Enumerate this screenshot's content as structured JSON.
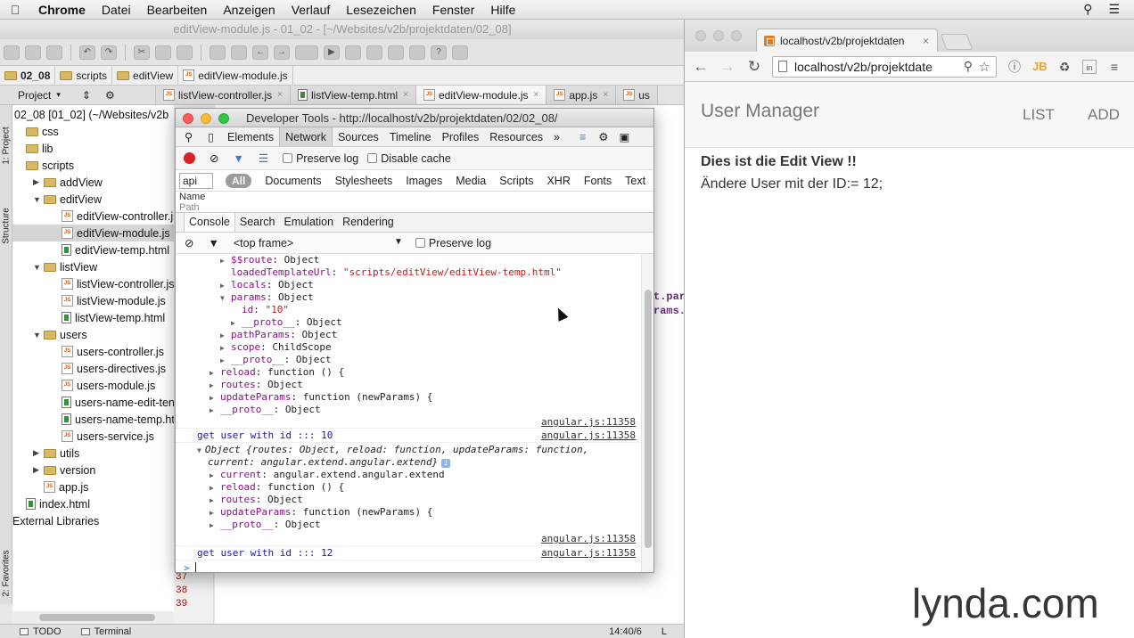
{
  "menubar": {
    "app": "Chrome",
    "items": [
      "Datei",
      "Bearbeiten",
      "Anzeigen",
      "Verlauf",
      "Lesezeichen",
      "Fenster",
      "Hilfe"
    ]
  },
  "ide": {
    "title": "editView-module.js - 01_02 - [~/Websites/v2b/projektdaten/02_08]",
    "breadcrumb": [
      "02_08",
      "scripts",
      "editView",
      "editView-module.js"
    ],
    "project_dropdown": "Project",
    "tabs": [
      {
        "label": "listView-controller.js",
        "type": "js"
      },
      {
        "label": "listView-temp.html",
        "type": "html"
      },
      {
        "label": "editView-module.js",
        "type": "js",
        "active": true
      },
      {
        "label": "app.js",
        "type": "js"
      },
      {
        "label": "us",
        "type": "js"
      }
    ],
    "side_tabs": {
      "project": "1: Project",
      "structure": "Structure",
      "favorites": "2: Favorites"
    },
    "tree_root": "02_08 [01_02] (~/Websites/v2b",
    "tree": [
      {
        "label": "css",
        "kind": "folder",
        "depth": 0,
        "arrow": "none"
      },
      {
        "label": "lib",
        "kind": "folder",
        "depth": 0,
        "arrow": "none"
      },
      {
        "label": "scripts",
        "kind": "folder",
        "depth": 0,
        "arrow": "none"
      },
      {
        "label": "addView",
        "kind": "folder",
        "depth": 1,
        "arrow": "right"
      },
      {
        "label": "editView",
        "kind": "folder",
        "depth": 1,
        "arrow": "down"
      },
      {
        "label": "editView-controller.js",
        "kind": "js",
        "depth": 2
      },
      {
        "label": "editView-module.js",
        "kind": "js",
        "depth": 2,
        "selected": true
      },
      {
        "label": "editView-temp.html",
        "kind": "html",
        "depth": 2
      },
      {
        "label": "listView",
        "kind": "folder",
        "depth": 1,
        "arrow": "down"
      },
      {
        "label": "listView-controller.js",
        "kind": "js",
        "depth": 2
      },
      {
        "label": "listView-module.js",
        "kind": "js",
        "depth": 2
      },
      {
        "label": "listView-temp.html",
        "kind": "html",
        "depth": 2
      },
      {
        "label": "users",
        "kind": "folder",
        "depth": 1,
        "arrow": "down"
      },
      {
        "label": "users-controller.js",
        "kind": "js",
        "depth": 2
      },
      {
        "label": "users-directives.js",
        "kind": "js",
        "depth": 2
      },
      {
        "label": "users-module.js",
        "kind": "js",
        "depth": 2
      },
      {
        "label": "users-name-edit-ten",
        "kind": "html",
        "depth": 2
      },
      {
        "label": "users-name-temp.ht",
        "kind": "html",
        "depth": 2
      },
      {
        "label": "users-service.js",
        "kind": "js",
        "depth": 2
      },
      {
        "label": "utils",
        "kind": "folder",
        "depth": 1,
        "arrow": "right"
      },
      {
        "label": "version",
        "kind": "folder",
        "depth": 1,
        "arrow": "right"
      },
      {
        "label": "app.js",
        "kind": "js",
        "depth": 1
      },
      {
        "label": "index.html",
        "kind": "html",
        "depth": 0
      },
      {
        "label": "External Libraries",
        "kind": "lib",
        "depth": -1
      }
    ],
    "gutter_lines": [
      "37",
      "38",
      "39"
    ],
    "editor_peek": [
      "t.par",
      "rams."
    ],
    "bottom_tabs": [
      "TODO",
      "Terminal"
    ],
    "cursor_pos": "14:40/6",
    "status_tail": "L"
  },
  "devtools": {
    "title": "Developer Tools - http://localhost/v2b/projektdaten/02/02_08/",
    "panels": [
      "Elements",
      "Network",
      "Sources",
      "Timeline",
      "Profiles",
      "Resources"
    ],
    "active_panel": "Network",
    "more": "»",
    "preserve_log": "Preserve log",
    "disable_cache": "Disable cache",
    "filter_value": "api",
    "filter_all": "All",
    "filter_types": [
      "Documents",
      "Stylesheets",
      "Images",
      "Media",
      "Scripts",
      "XHR",
      "Fonts",
      "Text"
    ],
    "name_header": "Name",
    "path_header": "Path",
    "drawer_tabs": [
      "Console",
      "Search",
      "Emulation",
      "Rendering"
    ],
    "frame_select": "<top frame>",
    "console_preserve": "Preserve log",
    "source_ref": "angular.js:11358",
    "prompt": ">",
    "console_lines": [
      {
        "indent": 4,
        "arrow": "▶",
        "parts": [
          {
            "t": "$$route",
            "c": "k"
          },
          {
            "t": ": Object",
            "c": "v"
          }
        ]
      },
      {
        "indent": 4,
        "arrow": "",
        "parts": [
          {
            "t": "loadedTemplateUrl",
            "c": "k"
          },
          {
            "t": ": ",
            "c": "v"
          },
          {
            "t": "\"scripts/editView/editView-temp.html\"",
            "c": "s"
          }
        ]
      },
      {
        "indent": 4,
        "arrow": "▶",
        "parts": [
          {
            "t": "locals",
            "c": "k"
          },
          {
            "t": ": Object",
            "c": "v"
          }
        ]
      },
      {
        "indent": 4,
        "arrow": "▼",
        "parts": [
          {
            "t": "params",
            "c": "k"
          },
          {
            "t": ": Object",
            "c": "v"
          }
        ]
      },
      {
        "indent": 5,
        "arrow": "",
        "parts": [
          {
            "t": "id",
            "c": "k"
          },
          {
            "t": ": ",
            "c": "v"
          },
          {
            "t": "\"10\"",
            "c": "s"
          }
        ]
      },
      {
        "indent": 5,
        "arrow": "▶",
        "parts": [
          {
            "t": "__proto__",
            "c": "k"
          },
          {
            "t": ": Object",
            "c": "v"
          }
        ]
      },
      {
        "indent": 4,
        "arrow": "▶",
        "parts": [
          {
            "t": "pathParams",
            "c": "k"
          },
          {
            "t": ": Object",
            "c": "v"
          }
        ]
      },
      {
        "indent": 4,
        "arrow": "▶",
        "parts": [
          {
            "t": "scope",
            "c": "k"
          },
          {
            "t": ": ChildScope",
            "c": "v"
          }
        ]
      },
      {
        "indent": 4,
        "arrow": "▶",
        "parts": [
          {
            "t": "__proto__",
            "c": "k"
          },
          {
            "t": ": Object",
            "c": "v"
          }
        ]
      },
      {
        "indent": 3,
        "arrow": "▶",
        "parts": [
          {
            "t": "reload",
            "c": "k"
          },
          {
            "t": ": function () {",
            "c": "v"
          }
        ]
      },
      {
        "indent": 3,
        "arrow": "▶",
        "parts": [
          {
            "t": "routes",
            "c": "k"
          },
          {
            "t": ": Object",
            "c": "v"
          }
        ]
      },
      {
        "indent": 3,
        "arrow": "▶",
        "parts": [
          {
            "t": "updateParams",
            "c": "k"
          },
          {
            "t": ": function (newParams) {",
            "c": "v"
          }
        ]
      },
      {
        "indent": 3,
        "arrow": "▶",
        "parts": [
          {
            "t": "__proto__",
            "c": "k"
          },
          {
            "t": ": Object",
            "c": "v"
          }
        ]
      }
    ],
    "log1": "get user with id :::  10",
    "object_summary": "Object {routes: Object, reload: function, updateParams: function,",
    "object_summary2": "current: angular.extend.angular.extend}",
    "object_lines": [
      {
        "parts": [
          {
            "t": "current",
            "c": "k"
          },
          {
            "t": ": angular.extend.angular.extend",
            "c": "v"
          }
        ]
      },
      {
        "parts": [
          {
            "t": "reload",
            "c": "k"
          },
          {
            "t": ": function () {",
            "c": "v"
          }
        ]
      },
      {
        "parts": [
          {
            "t": "routes",
            "c": "k"
          },
          {
            "t": ": Object",
            "c": "v"
          }
        ]
      },
      {
        "parts": [
          {
            "t": "updateParams",
            "c": "k"
          },
          {
            "t": ": function (newParams) {",
            "c": "v"
          }
        ]
      },
      {
        "parts": [
          {
            "t": "__proto__",
            "c": "k"
          },
          {
            "t": ": Object",
            "c": "v"
          }
        ]
      }
    ],
    "log2": "get user with id :::  12"
  },
  "browser": {
    "tab_title": "localhost/v2b/projektdaten",
    "url": "localhost/v2b/projektdate",
    "app_brand": "User Manager",
    "nav_links": [
      "LIST",
      "ADD"
    ],
    "heading": "Dies ist die Edit View !!",
    "text": "Ändere User mit der ID:= 12;",
    "watermark": "lynda.com"
  }
}
